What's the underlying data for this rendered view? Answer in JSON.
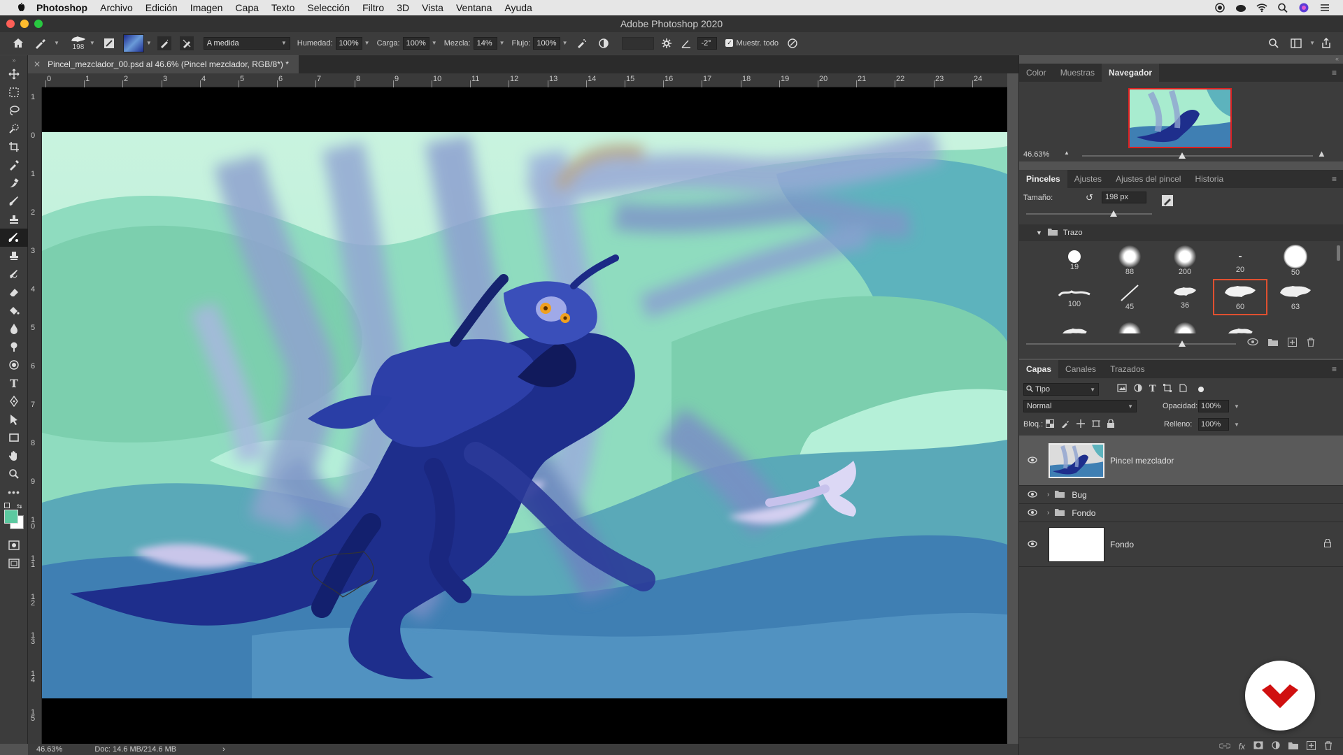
{
  "menubar": {
    "app_name": "Photoshop",
    "items": [
      "Archivo",
      "Edición",
      "Imagen",
      "Capa",
      "Texto",
      "Selección",
      "Filtro",
      "3D",
      "Vista",
      "Ventana",
      "Ayuda"
    ]
  },
  "window": {
    "title": "Adobe Photoshop 2020"
  },
  "options": {
    "brush_size": "198",
    "preset": "A medida",
    "humedad_label": "Humedad:",
    "humedad": "100%",
    "carga_label": "Carga:",
    "carga": "100%",
    "mezcla_label": "Mezcla:",
    "mezcla": "14%",
    "flujo_label": "Flujo:",
    "flujo": "100%",
    "angle": "-2°",
    "sample_all_label": "Muestr. todo"
  },
  "document": {
    "tab_title": "Pincel_mezclador_00.psd al 46.6% (Pincel mezclador, RGB/8*) *",
    "ruler_h": [
      "0",
      "1",
      "2",
      "3",
      "4",
      "5",
      "6",
      "7",
      "8",
      "9",
      "10",
      "11",
      "12",
      "13",
      "14",
      "15",
      "16",
      "17",
      "18",
      "19",
      "20",
      "21",
      "22",
      "23",
      "24"
    ],
    "ruler_v": [
      "1",
      "0",
      "1",
      "2",
      "3",
      "4",
      "5",
      "6",
      "7",
      "8",
      "9",
      "1 0",
      "1 1",
      "1 2",
      "1 3",
      "1 4",
      "1 5"
    ]
  },
  "status": {
    "zoom": "46.63%",
    "doc": "Doc: 14.6 MB/214.6 MB",
    "arrow": "›"
  },
  "navigator": {
    "tabs": [
      "Color",
      "Muestras",
      "Navegador"
    ],
    "active_tab": 2,
    "zoom": "46.63%"
  },
  "brushes": {
    "tabs": [
      "Pinceles",
      "Ajustes",
      "Ajustes del pincel",
      "Historia"
    ],
    "size_label": "Tamaño:",
    "size_value": "198 px",
    "group_name": "Trazo",
    "presets": [
      "19",
      "88",
      "200",
      "20",
      "50",
      "100",
      "45",
      "36",
      "60",
      "63"
    ],
    "selected_preset": "60"
  },
  "layers": {
    "tabs": [
      "Capas",
      "Canales",
      "Trazados"
    ],
    "filter": "Tipo",
    "blend_mode": "Normal",
    "opacity_label": "Opacidad:",
    "opacity": "100%",
    "lock_label": "Bloq.:",
    "fill_label": "Relleno:",
    "fill": "100%",
    "items": [
      {
        "name": "Pincel mezclador",
        "type": "pixel",
        "selected": true
      },
      {
        "name": "Bug",
        "type": "group"
      },
      {
        "name": "Fondo",
        "type": "group"
      },
      {
        "name": "Fondo",
        "type": "background",
        "locked": true
      }
    ]
  },
  "colors": {
    "accent_red": "#e02020",
    "selected_brush": "#e05030",
    "foreground_swatch": "#5cc9a0",
    "logo_red": "#d01010"
  }
}
